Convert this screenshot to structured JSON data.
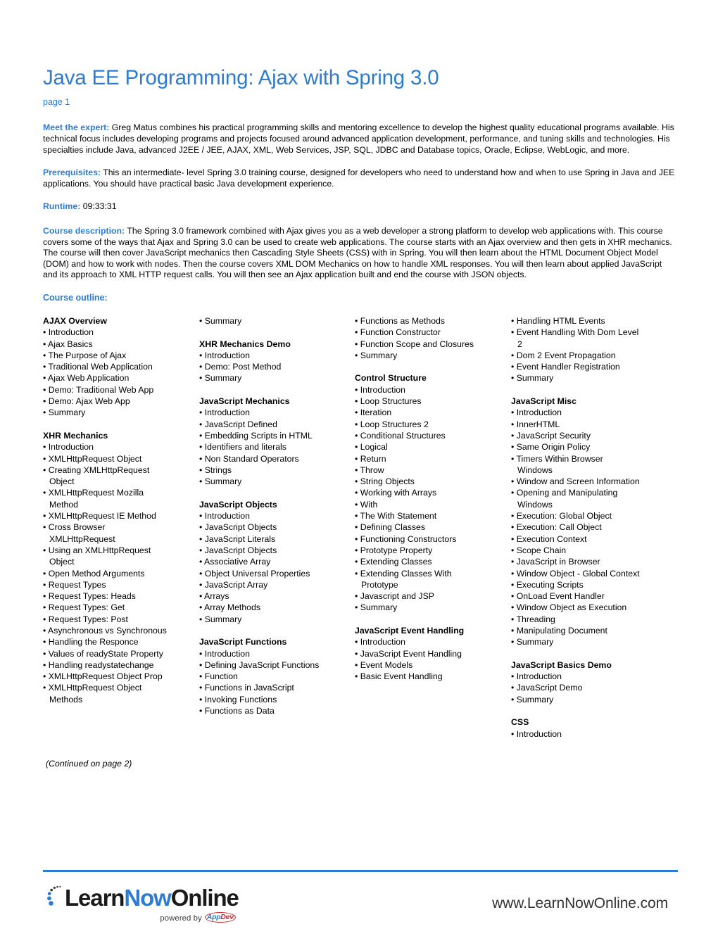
{
  "document": {
    "title": "Java EE Programming: Ajax with Spring 3.0",
    "page_label": "page 1"
  },
  "sections": {
    "expert": {
      "label": "Meet the expert:",
      "text": " Greg Matus combines his practical programming skills and mentoring excellence to develop the highest quality educational programs available. His technical focus includes developing programs and projects focused around advanced application development, performance, and tuning skills and technologies. His specialties include Java, advanced J2EE / JEE, AJAX, XML, Web Services, JSP, SQL, JDBC and Database topics, Oracle, Eclipse, WebLogic, and more."
    },
    "prerequisites": {
      "label": "Prerequisites:",
      "text": " This an intermediate- level Spring 3.0 training course, designed for developers who need to understand how and when to use Spring in Java and JEE applications. You should have practical basic Java development experience."
    },
    "runtime": {
      "label": "Runtime:",
      "text": " 09:33:31"
    },
    "description": {
      "label": "Course description:",
      "text": " The Spring 3.0 framework combined with Ajax gives you as a web developer a strong platform to develop web applications with. This course covers some of the ways that Ajax and Spring 3.0 can be used to create web applications. The course starts with an Ajax overview and then gets in XHR mechanics. The course will then cover JavaScript mechanics then Cascading Style Sheets (CSS) with in Spring. You will then learn about the HTML Document Object Model (DOM) and how to work with nodes. Then the course covers XML DOM Mechanics on how to handle XML responses. You will then learn about applied JavaScript and its approach to XML HTTP request calls. You will then see an Ajax application built and end the course with JSON objects."
    },
    "outline_heading": "Course outline:"
  },
  "outline": {
    "columns": [
      {
        "lines": [
          {
            "type": "section",
            "text": "AJAX Overview"
          },
          {
            "type": "bullet",
            "text": "• Introduction"
          },
          {
            "type": "bullet",
            "text": "• Ajax Basics"
          },
          {
            "type": "bullet",
            "text": "• The Purpose of Ajax"
          },
          {
            "type": "bullet",
            "text": "• Traditional Web Application"
          },
          {
            "type": "bullet",
            "text": "• Ajax Web Application"
          },
          {
            "type": "bullet",
            "text": "• Demo: Traditional Web App"
          },
          {
            "type": "bullet",
            "text": "• Demo: Ajax Web App"
          },
          {
            "type": "bullet",
            "text": "• Summary"
          },
          {
            "type": "blank",
            "text": ""
          },
          {
            "type": "section",
            "text": "XHR Mechanics"
          },
          {
            "type": "bullet",
            "text": "• Introduction"
          },
          {
            "type": "bullet",
            "text": "• XMLHttpRequest Object"
          },
          {
            "type": "bullet",
            "text": "• Creating XMLHttpRequest"
          },
          {
            "type": "cont",
            "text": "Object"
          },
          {
            "type": "bullet",
            "text": "• XMLHttpRequest Mozilla"
          },
          {
            "type": "cont",
            "text": "Method"
          },
          {
            "type": "bullet",
            "text": "• XMLHttpRequest IE Method"
          },
          {
            "type": "bullet",
            "text": "• Cross Browser"
          },
          {
            "type": "cont",
            "text": "XMLHttpRequest"
          },
          {
            "type": "bullet",
            "text": "• Using an XMLHttpRequest"
          },
          {
            "type": "cont",
            "text": "Object"
          },
          {
            "type": "bullet",
            "text": "• Open Method Arguments"
          },
          {
            "type": "bullet",
            "text": "• Request Types"
          },
          {
            "type": "bullet",
            "text": "• Request Types: Heads"
          },
          {
            "type": "bullet",
            "text": "• Request Types: Get"
          },
          {
            "type": "bullet",
            "text": "• Request Types: Post"
          },
          {
            "type": "bullet",
            "text": "• Asynchronous vs Synchronous"
          },
          {
            "type": "bullet",
            "text": "• Handling the Responce"
          },
          {
            "type": "bullet",
            "text": "• Values of readyState Property"
          },
          {
            "type": "bullet",
            "text": "• Handling readystatechange"
          },
          {
            "type": "bullet",
            "text": "• XMLHttpRequest Object Prop"
          },
          {
            "type": "bullet",
            "text": "• XMLHttpRequest Object"
          },
          {
            "type": "cont",
            "text": "Methods"
          }
        ]
      },
      {
        "lines": [
          {
            "type": "bullet",
            "text": "• Summary"
          },
          {
            "type": "blank",
            "text": ""
          },
          {
            "type": "section",
            "text": "XHR Mechanics Demo"
          },
          {
            "type": "bullet",
            "text": "• Introduction"
          },
          {
            "type": "bullet",
            "text": "• Demo: Post Method"
          },
          {
            "type": "bullet",
            "text": "• Summary"
          },
          {
            "type": "blank",
            "text": ""
          },
          {
            "type": "section",
            "text": "JavaScript Mechanics"
          },
          {
            "type": "bullet",
            "text": "• Introduction"
          },
          {
            "type": "bullet",
            "text": "• JavaScript Defined"
          },
          {
            "type": "bullet",
            "text": "• Embedding Scripts in HTML"
          },
          {
            "type": "bullet",
            "text": "• Identifiers and literals"
          },
          {
            "type": "bullet",
            "text": "• Non Standard Operators"
          },
          {
            "type": "bullet",
            "text": "• Strings"
          },
          {
            "type": "bullet",
            "text": "• Summary"
          },
          {
            "type": "blank",
            "text": ""
          },
          {
            "type": "section",
            "text": "JavaScript Objects"
          },
          {
            "type": "bullet",
            "text": "• Introduction"
          },
          {
            "type": "bullet",
            "text": "• JavaScript Objects"
          },
          {
            "type": "bullet",
            "text": "• JavaScript Literals"
          },
          {
            "type": "bullet",
            "text": "• JavaScript Objects"
          },
          {
            "type": "bullet",
            "text": "• Associative Array"
          },
          {
            "type": "bullet",
            "text": "• Object Universal Properties"
          },
          {
            "type": "bullet",
            "text": "• JavaScript Array"
          },
          {
            "type": "bullet",
            "text": "• Arrays"
          },
          {
            "type": "bullet",
            "text": "• Array Methods"
          },
          {
            "type": "bullet",
            "text": "• Summary"
          },
          {
            "type": "blank",
            "text": ""
          },
          {
            "type": "section",
            "text": "JavaScript Functions"
          },
          {
            "type": "bullet",
            "text": "• Introduction"
          },
          {
            "type": "bullet",
            "text": "• Defining JavaScript Functions"
          },
          {
            "type": "bullet",
            "text": "• Function"
          },
          {
            "type": "bullet",
            "text": "• Functions in JavaScript"
          },
          {
            "type": "bullet",
            "text": "• Invoking Functions"
          },
          {
            "type": "bullet",
            "text": "• Functions as Data"
          }
        ]
      },
      {
        "lines": [
          {
            "type": "bullet",
            "text": "• Functions as Methods"
          },
          {
            "type": "bullet",
            "text": "• Function Constructor"
          },
          {
            "type": "bullet",
            "text": "• Function Scope and Closures"
          },
          {
            "type": "bullet",
            "text": "• Summary"
          },
          {
            "type": "blank",
            "text": ""
          },
          {
            "type": "section",
            "text": "Control Structure"
          },
          {
            "type": "bullet",
            "text": "• Introduction"
          },
          {
            "type": "bullet",
            "text": "• Loop Structures"
          },
          {
            "type": "bullet",
            "text": "• Iteration"
          },
          {
            "type": "bullet",
            "text": "• Loop Structures 2"
          },
          {
            "type": "bullet",
            "text": "• Conditional Structures"
          },
          {
            "type": "bullet",
            "text": "• Logical"
          },
          {
            "type": "bullet",
            "text": "• Return"
          },
          {
            "type": "bullet",
            "text": "• Throw"
          },
          {
            "type": "bullet",
            "text": "• String Objects"
          },
          {
            "type": "bullet",
            "text": "• Working with Arrays"
          },
          {
            "type": "bullet",
            "text": "• With"
          },
          {
            "type": "bullet",
            "text": "• The With Statement"
          },
          {
            "type": "bullet",
            "text": "• Defining Classes"
          },
          {
            "type": "bullet",
            "text": "• Functioning Constructors"
          },
          {
            "type": "bullet",
            "text": "• Prototype Property"
          },
          {
            "type": "bullet",
            "text": "• Extending Classes"
          },
          {
            "type": "bullet",
            "text": "• Extending Classes With"
          },
          {
            "type": "cont",
            "text": "Prototype"
          },
          {
            "type": "bullet",
            "text": "• Javascript and JSP"
          },
          {
            "type": "bullet",
            "text": "• Summary"
          },
          {
            "type": "blank",
            "text": ""
          },
          {
            "type": "section",
            "text": "JavaScript Event Handling"
          },
          {
            "type": "bullet",
            "text": "• Introduction"
          },
          {
            "type": "bullet",
            "text": "• JavaScript Event Handling"
          },
          {
            "type": "bullet",
            "text": "• Event Models"
          },
          {
            "type": "bullet",
            "text": "• Basic Event Handling"
          }
        ]
      },
      {
        "lines": [
          {
            "type": "bullet",
            "text": "• Handling HTML Events"
          },
          {
            "type": "bullet",
            "text": "• Event Handling With Dom Level"
          },
          {
            "type": "cont",
            "text": "2"
          },
          {
            "type": "bullet",
            "text": "• Dom 2 Event Propagation"
          },
          {
            "type": "bullet",
            "text": "• Event Handler Registration"
          },
          {
            "type": "bullet",
            "text": "• Summary"
          },
          {
            "type": "blank",
            "text": ""
          },
          {
            "type": "section",
            "text": "JavaScript Misc"
          },
          {
            "type": "bullet",
            "text": "• Introduction"
          },
          {
            "type": "bullet",
            "text": "• InnerHTML"
          },
          {
            "type": "bullet",
            "text": "• JavaScript Security"
          },
          {
            "type": "bullet",
            "text": "• Same Origin Policy"
          },
          {
            "type": "bullet",
            "text": "• Timers Within Browser"
          },
          {
            "type": "cont",
            "text": "Windows"
          },
          {
            "type": "bullet",
            "text": "• Window and Screen Information"
          },
          {
            "type": "bullet",
            "text": "• Opening and Manipulating"
          },
          {
            "type": "cont",
            "text": "Windows"
          },
          {
            "type": "bullet",
            "text": "• Execution: Global Object"
          },
          {
            "type": "bullet",
            "text": "• Execution: Call Object"
          },
          {
            "type": "bullet",
            "text": "• Execution Context"
          },
          {
            "type": "bullet",
            "text": "• Scope Chain"
          },
          {
            "type": "bullet",
            "text": "• JavaScript in Browser"
          },
          {
            "type": "bullet",
            "text": "• Window Object - Global Context"
          },
          {
            "type": "bullet",
            "text": "• Executing Scripts"
          },
          {
            "type": "bullet",
            "text": "• OnLoad Event Handler"
          },
          {
            "type": "bullet",
            "text": "• Window Object as Execution"
          },
          {
            "type": "bullet",
            "text": "• Threading"
          },
          {
            "type": "bullet",
            "text": "• Manipulating Document"
          },
          {
            "type": "bullet",
            "text": "• Summary"
          },
          {
            "type": "blank",
            "text": ""
          },
          {
            "type": "section",
            "text": "JavaScript Basics Demo"
          },
          {
            "type": "bullet",
            "text": "• Introduction"
          },
          {
            "type": "bullet",
            "text": "• JavaScript Demo"
          },
          {
            "type": "bullet",
            "text": "• Summary"
          },
          {
            "type": "blank",
            "text": ""
          },
          {
            "type": "section",
            "text": "CSS"
          },
          {
            "type": "bullet",
            "text": "• Introduction"
          }
        ]
      }
    ],
    "continued_note": "(Continued on page 2)"
  },
  "footer": {
    "logo": {
      "part1": "Learn",
      "part2": "Now",
      "part3": "Online",
      "powered_by": "powered by",
      "badge_app": "App",
      "badge_dev": "Dev"
    },
    "url": "www.LearnNowOnline.com"
  },
  "colors": {
    "accent_blue": "#2E7BD2",
    "badge_red": "#d8232a",
    "text_black": "#000000"
  }
}
